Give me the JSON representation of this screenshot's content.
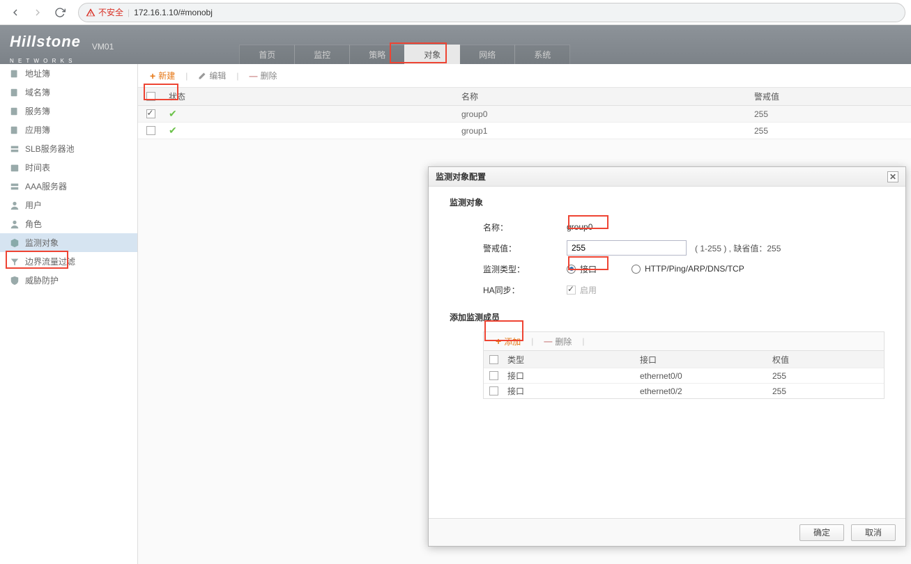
{
  "browser": {
    "insecure_label": "不安全",
    "url": "172.16.1.10/#monobj"
  },
  "header": {
    "brand": "Hillstone",
    "brand_sub": "N E T W O R K S",
    "vm": "VM01"
  },
  "tabs": [
    "首页",
    "监控",
    "策略",
    "对象",
    "网络",
    "系统"
  ],
  "tabs_active": 3,
  "sidebar": {
    "items": [
      "地址簿",
      "域名簿",
      "服务簿",
      "应用簿",
      "SLB服务器池",
      "时间表",
      "AAA服务器",
      "用户",
      "角色",
      "监测对象",
      "边界流量过滤",
      "威胁防护"
    ],
    "active": 9
  },
  "toolbar": {
    "new": "新建",
    "edit": "编辑",
    "delete": "删除"
  },
  "grid": {
    "headers": {
      "status": "状态",
      "name": "名称",
      "warn": "警戒值"
    },
    "rows": [
      {
        "checked": true,
        "status": "ok",
        "name": "group0",
        "warn": "255"
      },
      {
        "checked": false,
        "status": "ok",
        "name": "group1",
        "warn": "255"
      }
    ]
  },
  "dialog": {
    "title": "监测对象配置",
    "section1": "监测对象",
    "name_label": "名称：",
    "name_value": "group0",
    "warn_label": "警戒值：",
    "warn_value": "255",
    "warn_hint": "( 1-255 ) , 缺省值：255",
    "type_label": "监测类型：",
    "type_radio1": "接口",
    "type_radio2": "HTTP/Ping/ARP/DNS/TCP",
    "ha_label": "HA同步：",
    "ha_value": "启用",
    "section2": "添加监测成员",
    "add_btn": "添加",
    "del_btn": "删除",
    "sub_headers": {
      "type": "类型",
      "iface": "接口",
      "weight": "权值"
    },
    "sub_rows": [
      {
        "type": "接口",
        "iface": "ethernet0/0",
        "weight": "255"
      },
      {
        "type": "接口",
        "iface": "ethernet0/2",
        "weight": "255"
      }
    ],
    "ok": "确定",
    "cancel": "取消"
  }
}
